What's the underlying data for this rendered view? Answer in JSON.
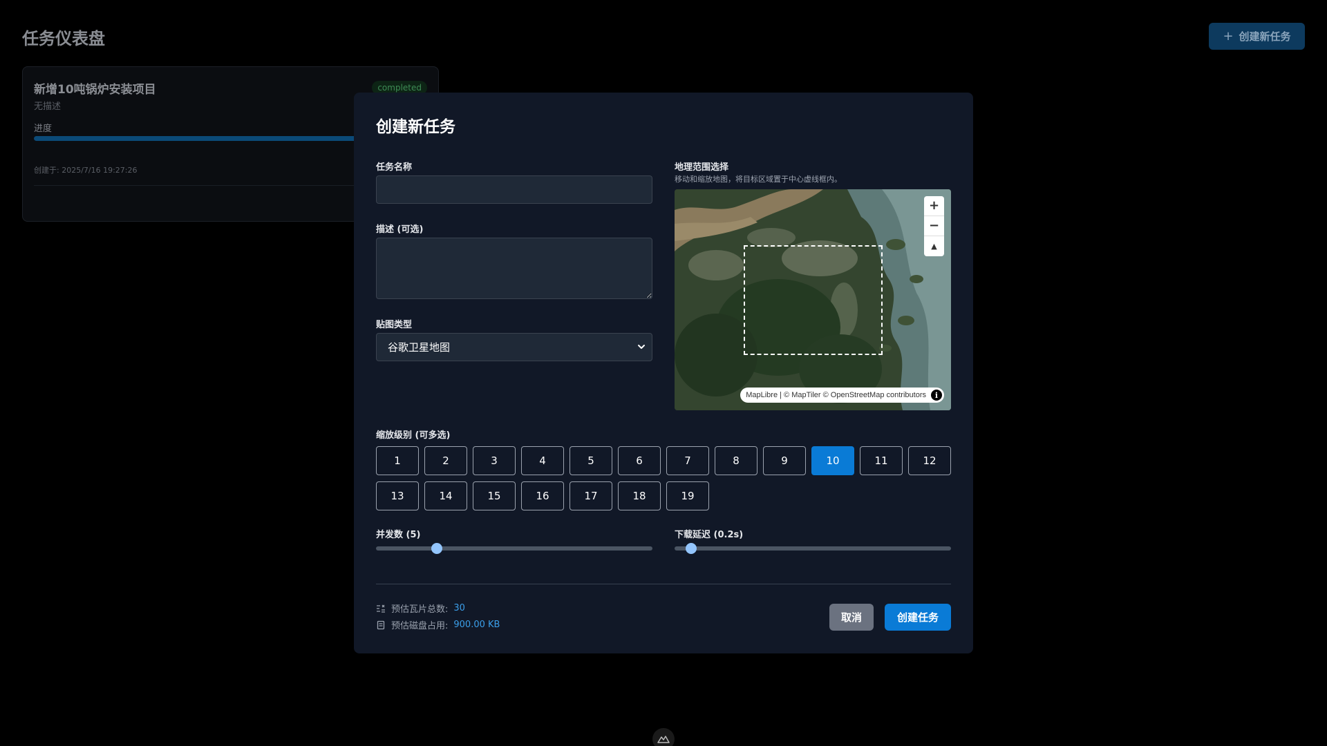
{
  "header": {
    "title": "任务仪表盘",
    "create_button_label": "创建新任务",
    "create_button_icon": "plus-icon"
  },
  "task_card": {
    "title": "新增10吨锅炉安装项目",
    "description": "无描述",
    "status": "completed",
    "progress_label": "进度",
    "progress": 1.0,
    "created_at": "创建于: 2025/7/16 19:27:26"
  },
  "modal": {
    "title": "创建新任务",
    "task_name": {
      "label": "任务名称",
      "value": ""
    },
    "description": {
      "label": "描述 (可选)",
      "value": ""
    },
    "tile_type": {
      "label": "贴图类型",
      "selected": "谷歌卫星地图"
    },
    "map": {
      "label": "地理范围选择",
      "hint": "移动和缩放地图，将目标区域置于中心虚线框内。",
      "zoom_in": "+",
      "zoom_out": "−",
      "compass": "▲",
      "attribution": "MapLibre | © MapTiler © OpenStreetMap contributors",
      "info": "i"
    },
    "zoom_levels": {
      "label": "缩放级别 (可多选)",
      "levels": [
        "1",
        "2",
        "3",
        "4",
        "5",
        "6",
        "7",
        "8",
        "9",
        "10",
        "11",
        "12",
        "13",
        "14",
        "15",
        "16",
        "17",
        "18",
        "19"
      ],
      "selected": [
        "10"
      ]
    },
    "concurrency": {
      "label": "并发数 (5)",
      "fraction": 0.22
    },
    "delay": {
      "label": "下载延迟 (0.2s)",
      "fraction": 0.06
    },
    "estimates": {
      "tiles_label": "预估瓦片总数:",
      "tiles_value": "30",
      "disk_label": "预估磁盘占用:",
      "disk_value": "900.00 KB"
    },
    "cancel_label": "取消",
    "submit_label": "创建任务"
  },
  "colors": {
    "accent": "#0a7bd6",
    "modal_bg": "#111827",
    "status_green": "#3e8c55",
    "estimate_blue": "#3b9fea"
  }
}
